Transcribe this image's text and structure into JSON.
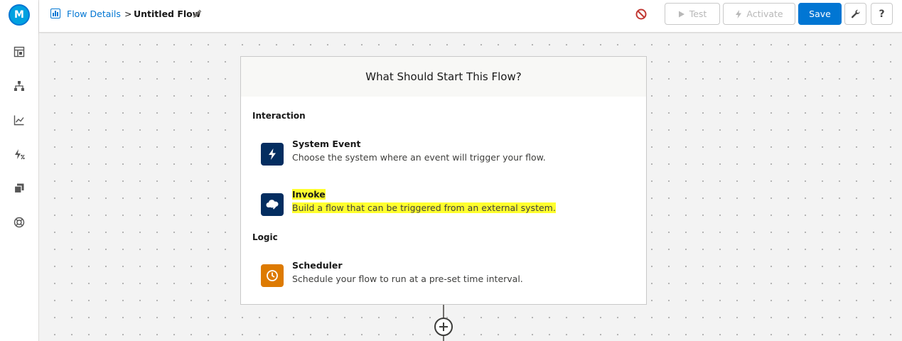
{
  "app": {
    "logo_letter": "M",
    "brand_color": "#0176d3"
  },
  "rail": {
    "items": [
      {
        "name": "dashboard-icon"
      },
      {
        "name": "hierarchy-icon"
      },
      {
        "name": "line-chart-icon"
      },
      {
        "name": "bolt-percent-icon"
      },
      {
        "name": "copy-icon"
      },
      {
        "name": "help-ring-icon"
      }
    ]
  },
  "header": {
    "breadcrumb_link": "Flow Details",
    "breadcrumb_sep": ">",
    "flow_name": "Untitled Flow",
    "buttons": {
      "test": "Test",
      "activate": "Activate",
      "save": "Save",
      "help": "?"
    }
  },
  "card": {
    "title": "What Should Start This Flow?",
    "sections": {
      "interaction": "Interaction",
      "logic": "Logic"
    },
    "options": {
      "system_event": {
        "title": "System Event",
        "description": "Choose the system where an event will trigger your flow.",
        "color": "#032d60"
      },
      "invoke": {
        "title": "Invoke",
        "description": "Build a flow that can be triggered from an external system.",
        "color": "#032d60"
      },
      "scheduler": {
        "title": "Scheduler",
        "description": "Schedule your flow to run at a pre-set time interval.",
        "color": "#dd7a01"
      }
    }
  }
}
